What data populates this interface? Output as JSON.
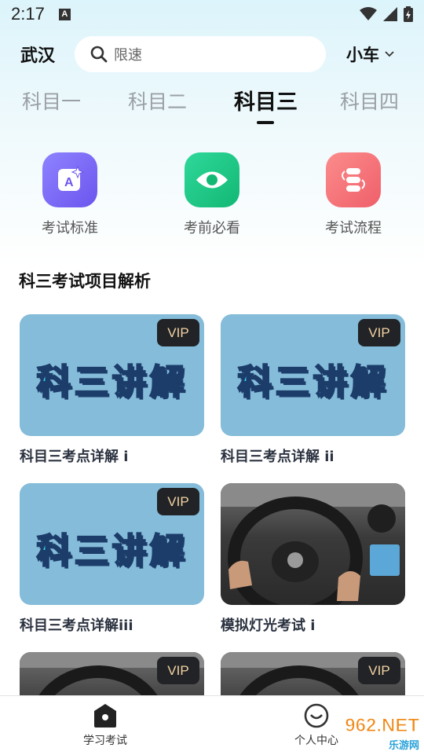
{
  "status_bar": {
    "time": "2:17",
    "notification_letter": "A"
  },
  "header": {
    "city": "武汉",
    "search_placeholder": "限速",
    "vehicle_type": "小车"
  },
  "tabs": [
    {
      "label": "科目一",
      "active": false
    },
    {
      "label": "科目二",
      "active": false
    },
    {
      "label": "科目三",
      "active": true
    },
    {
      "label": "科目四",
      "active": false
    }
  ],
  "features": [
    {
      "label": "考试标准",
      "icon": "exam-standard-icon",
      "color": "#7b6cf6"
    },
    {
      "label": "考前必看",
      "icon": "eye-icon",
      "color": "#22c987"
    },
    {
      "label": "考试流程",
      "icon": "process-icon",
      "color": "#f26d73"
    }
  ],
  "section": {
    "title": "科三考试项目解析"
  },
  "cards": [
    {
      "title": "科目三考点详解 i",
      "thumb_text": "科三讲解",
      "badge": "VIP"
    },
    {
      "title": "科目三考点详解 ii",
      "thumb_text": "科三讲解",
      "badge": "VIP"
    },
    {
      "title": "科目三考点详解iii",
      "thumb_text": "科三讲解",
      "badge": "VIP"
    },
    {
      "title": "模拟灯光考试 i",
      "thumb_text": "",
      "badge": ""
    },
    {
      "title": "",
      "thumb_text": "",
      "badge": "VIP"
    },
    {
      "title": "",
      "thumb_text": "",
      "badge": "VIP"
    }
  ],
  "bottom_nav": [
    {
      "label": "学习考试",
      "icon": "home-icon",
      "active": true
    },
    {
      "label": "个人中心",
      "icon": "profile-icon",
      "active": false
    }
  ],
  "watermark": {
    "top": "962.NET",
    "bottom": "乐游网"
  }
}
